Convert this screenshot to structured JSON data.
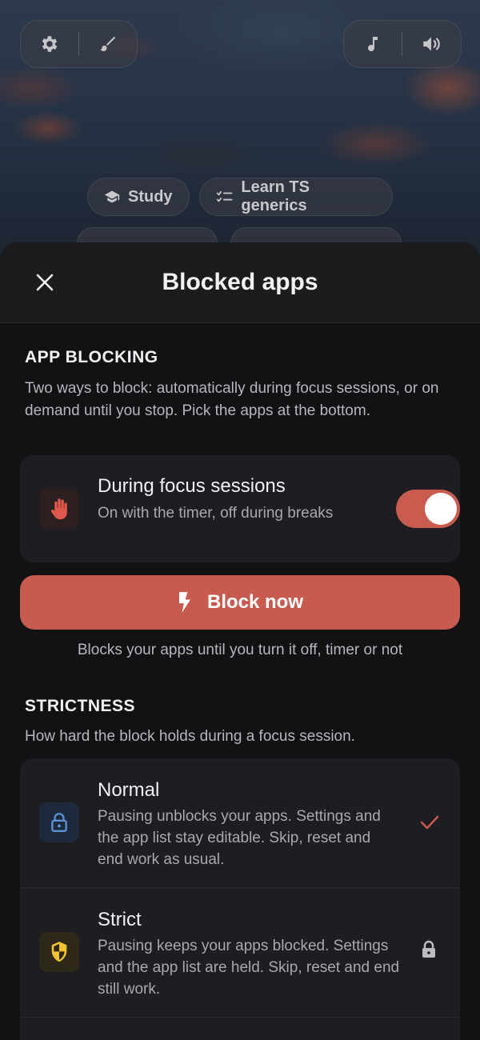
{
  "top_bar": {
    "left_icons": [
      "gear-icon",
      "brush-icon"
    ],
    "right_icons": [
      "music-note-icon",
      "volume-icon"
    ]
  },
  "chips": [
    {
      "label": "Study",
      "icon": "graduation-cap-icon"
    },
    {
      "label": "Learn TS generics",
      "icon": "checklist-icon"
    }
  ],
  "sheet": {
    "title": "Blocked apps",
    "close_icon": "close-icon"
  },
  "app_blocking": {
    "heading": "APP BLOCKING",
    "description": "Two ways to block: automatically during focus sessions, or on demand until you stop. Pick the apps at the bottom.",
    "focus_row": {
      "title": "During focus sessions",
      "subtitle": "On with the timer, off during breaks",
      "icon": "hand-stop-icon",
      "toggle_on": true
    },
    "block_now_label": "Block now",
    "block_now_icon": "lightning-icon",
    "block_now_note": "Blocks your apps until you turn it off, timer or not"
  },
  "strictness": {
    "heading": "STRICTNESS",
    "description": "How hard the block holds during a focus session.",
    "options": [
      {
        "title": "Normal",
        "description": "Pausing unblocks your apps. Settings and the app list stay editable. Skip, reset and end work as usual.",
        "icon": "padlock-open-icon",
        "state": "selected",
        "state_icon": "checkmark-icon"
      },
      {
        "title": "Strict",
        "description": "Pausing keeps your apps blocked. Settings and the app list are held. Skip, reset and end still work.",
        "icon": "shield-icon",
        "state": "locked",
        "state_icon": "lock-icon"
      }
    ]
  },
  "colors": {
    "accent": "#c85b50",
    "check": "#c95b4f",
    "normal_icon": "#5b8fd6",
    "strict_icon": "#f2c230"
  }
}
